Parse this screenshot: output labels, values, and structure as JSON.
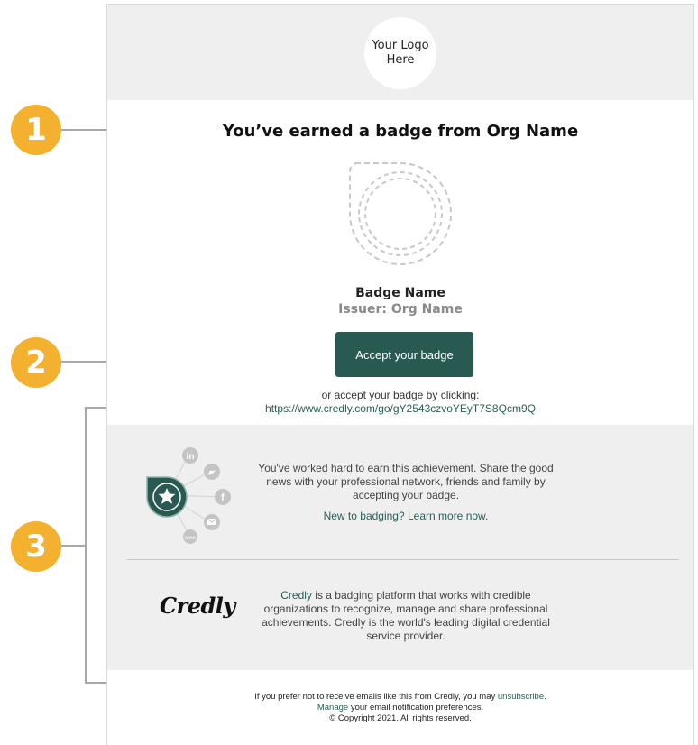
{
  "header": {
    "logo_text": "Your Logo Here"
  },
  "main": {
    "title": "You’ve earned a badge from Org Name",
    "badge_name": "Badge Name",
    "issuer": "Issuer: Org Name",
    "accept_button": "Accept your badge",
    "or_text": "or accept your badge by clicking:",
    "accept_url": "https://www.credly.com/go/gY2543czvoYEyT7S8Qcm9Q"
  },
  "share": {
    "text": "You've worked hard to earn this achievement. Share the good news with your professional network, friends and family by accepting your badge.",
    "learn_more": "New to badging? Learn more now.",
    "social_labels": {
      "linkedin": "in",
      "facebook": "f",
      "more": "www"
    }
  },
  "about": {
    "logo_text": "Credly",
    "link_text": "Credly",
    "description": " is a badging platform that works with credible organizations to recognize, manage and share professional achievements. Credly is the world's leading digital credential service provider."
  },
  "footer": {
    "line1_prefix": "If you prefer not to receive emails like this from Credly, you may ",
    "unsubscribe": "unsubscribe",
    "line1_suffix": ".",
    "manage": "Manage",
    "line2_suffix": " your email notification preferences.",
    "copyright": "© Copyright 2021. All rights reserved."
  },
  "markers": [
    "1",
    "2",
    "3"
  ],
  "colors": {
    "accent": "#285a52",
    "marker": "#f4b02f",
    "link": "#2a5f56",
    "panel": "#efefef"
  }
}
